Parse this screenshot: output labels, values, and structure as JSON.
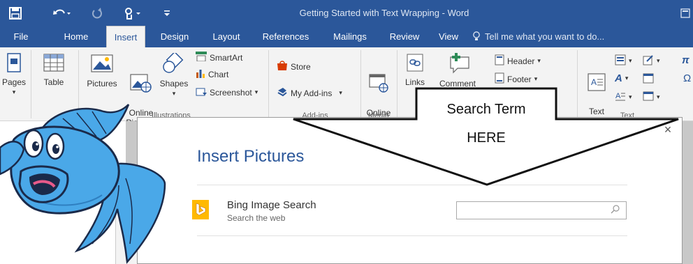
{
  "window": {
    "title": "Getting Started with Text Wrapping - Word"
  },
  "tabs": [
    {
      "label": "File"
    },
    {
      "label": "Home"
    },
    {
      "label": "Insert"
    },
    {
      "label": "Design"
    },
    {
      "label": "Layout"
    },
    {
      "label": "References"
    },
    {
      "label": "Mailings"
    },
    {
      "label": "Review"
    },
    {
      "label": "View"
    }
  ],
  "tell_me": "Tell me what you want to do...",
  "ribbon": {
    "pages": "Pages",
    "table": "Table",
    "pictures": "Pictures",
    "online_pictures": "Online\nPictures",
    "shapes": "Shapes",
    "smartart": "SmartArt",
    "chart": "Chart",
    "screenshot": "Screenshot",
    "store": "Store",
    "my_addins": "My Add-ins",
    "online_video": "Online\nVideo",
    "links": "Links",
    "comment": "Comment",
    "header": "Header",
    "footer": "Footer",
    "text_box": "Text\nBox",
    "groups": {
      "illustrations": "Illustrations",
      "addins": "Add-ins",
      "media": "Media",
      "text": "Text"
    }
  },
  "dialog": {
    "title": "Insert Pictures",
    "close": "×",
    "bing_label": "Bing Image Search",
    "bing_sub": "Search the web",
    "search_value": "",
    "search_placeholder": ""
  },
  "callout": {
    "line1": "Search Term",
    "line2": "HERE"
  },
  "colors": {
    "word_blue": "#2b579a",
    "bing_yellow": "#ffb900",
    "fish_blue": "#4aa8e8"
  }
}
